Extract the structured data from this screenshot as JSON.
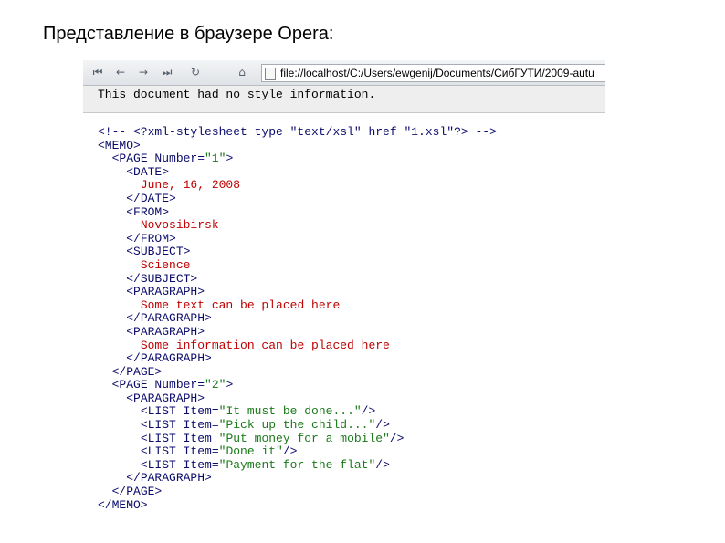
{
  "slide": {
    "title": "Представление в браузере Opera:"
  },
  "browser": {
    "toolbar": {
      "icons": [
        "first-page-icon",
        "back-icon",
        "forward-icon",
        "last-page-icon",
        "reload-icon",
        "home-icon"
      ],
      "url": "file://localhost/C:/Users/ewgenij/Documents/СибГУТИ/2009-autu"
    },
    "notice": "This document had no style information."
  },
  "xml": {
    "lines": [
      {
        "indent": 0,
        "parts": [
          {
            "t": "<!-- <?xml-stylesheet type \"text/xsl\" href \"1.xsl\"?> -->",
            "c": "tag"
          }
        ]
      },
      {
        "indent": 0,
        "parts": [
          {
            "t": "<MEMO>",
            "c": "tag"
          }
        ]
      },
      {
        "indent": 1,
        "parts": [
          {
            "t": "<PAGE Number=",
            "c": "tag"
          },
          {
            "t": "\"1\"",
            "c": "val"
          },
          {
            "t": ">",
            "c": "tag"
          }
        ]
      },
      {
        "indent": 2,
        "parts": [
          {
            "t": "<DATE>",
            "c": "tag"
          }
        ]
      },
      {
        "indent": 3,
        "parts": [
          {
            "t": "June, 16, 2008",
            "c": "txt"
          }
        ]
      },
      {
        "indent": 2,
        "parts": [
          {
            "t": "</DATE>",
            "c": "tag"
          }
        ]
      },
      {
        "indent": 2,
        "parts": [
          {
            "t": "<FROM>",
            "c": "tag"
          }
        ]
      },
      {
        "indent": 3,
        "parts": [
          {
            "t": "Novosibirsk",
            "c": "txt"
          }
        ]
      },
      {
        "indent": 2,
        "parts": [
          {
            "t": "</FROM>",
            "c": "tag"
          }
        ]
      },
      {
        "indent": 2,
        "parts": [
          {
            "t": "<SUBJECT>",
            "c": "tag"
          }
        ]
      },
      {
        "indent": 3,
        "parts": [
          {
            "t": "Science",
            "c": "txt"
          }
        ]
      },
      {
        "indent": 2,
        "parts": [
          {
            "t": "</SUBJECT>",
            "c": "tag"
          }
        ]
      },
      {
        "indent": 2,
        "parts": [
          {
            "t": "<PARAGRAPH>",
            "c": "tag"
          }
        ]
      },
      {
        "indent": 3,
        "parts": [
          {
            "t": "Some text can be placed here",
            "c": "txt"
          }
        ]
      },
      {
        "indent": 2,
        "parts": [
          {
            "t": "</PARAGRAPH>",
            "c": "tag"
          }
        ]
      },
      {
        "indent": 2,
        "parts": [
          {
            "t": "<PARAGRAPH>",
            "c": "tag"
          }
        ]
      },
      {
        "indent": 3,
        "parts": [
          {
            "t": "Some information can be placed here",
            "c": "txt"
          }
        ]
      },
      {
        "indent": 2,
        "parts": [
          {
            "t": "</PARAGRAPH>",
            "c": "tag"
          }
        ]
      },
      {
        "indent": 1,
        "parts": [
          {
            "t": "</PAGE>",
            "c": "tag"
          }
        ]
      },
      {
        "indent": 1,
        "parts": [
          {
            "t": "<PAGE Number=",
            "c": "tag"
          },
          {
            "t": "\"2\"",
            "c": "val"
          },
          {
            "t": ">",
            "c": "tag"
          }
        ]
      },
      {
        "indent": 2,
        "parts": [
          {
            "t": "<PARAGRAPH>",
            "c": "tag"
          }
        ]
      },
      {
        "indent": 3,
        "parts": [
          {
            "t": "<LIST Item=",
            "c": "tag"
          },
          {
            "t": "\"It must be done...\"",
            "c": "val"
          },
          {
            "t": "/>",
            "c": "tag"
          }
        ]
      },
      {
        "indent": 3,
        "parts": [
          {
            "t": "<LIST Item=",
            "c": "tag"
          },
          {
            "t": "\"Pick up the child...\"",
            "c": "val"
          },
          {
            "t": "/>",
            "c": "tag"
          }
        ]
      },
      {
        "indent": 3,
        "parts": [
          {
            "t": "<LIST Item ",
            "c": "tag"
          },
          {
            "t": "\"Put money for a mobile\"",
            "c": "val"
          },
          {
            "t": "/>",
            "c": "tag"
          }
        ]
      },
      {
        "indent": 3,
        "parts": [
          {
            "t": "<LIST Item=",
            "c": "tag"
          },
          {
            "t": "\"Done it\"",
            "c": "val"
          },
          {
            "t": "/>",
            "c": "tag"
          }
        ]
      },
      {
        "indent": 3,
        "parts": [
          {
            "t": "<LIST Item=",
            "c": "tag"
          },
          {
            "t": "\"Payment for the flat\"",
            "c": "val"
          },
          {
            "t": "/>",
            "c": "tag"
          }
        ]
      },
      {
        "indent": 2,
        "parts": [
          {
            "t": "</PARAGRAPH>",
            "c": "tag"
          }
        ]
      },
      {
        "indent": 1,
        "parts": [
          {
            "t": "</PAGE>",
            "c": "tag"
          }
        ]
      },
      {
        "indent": 0,
        "parts": [
          {
            "t": "</MEMO>",
            "c": "tag"
          }
        ]
      }
    ]
  },
  "colors": {
    "tag": "#0b0b6b",
    "text": "#c00000",
    "value": "#1a7a1a"
  }
}
